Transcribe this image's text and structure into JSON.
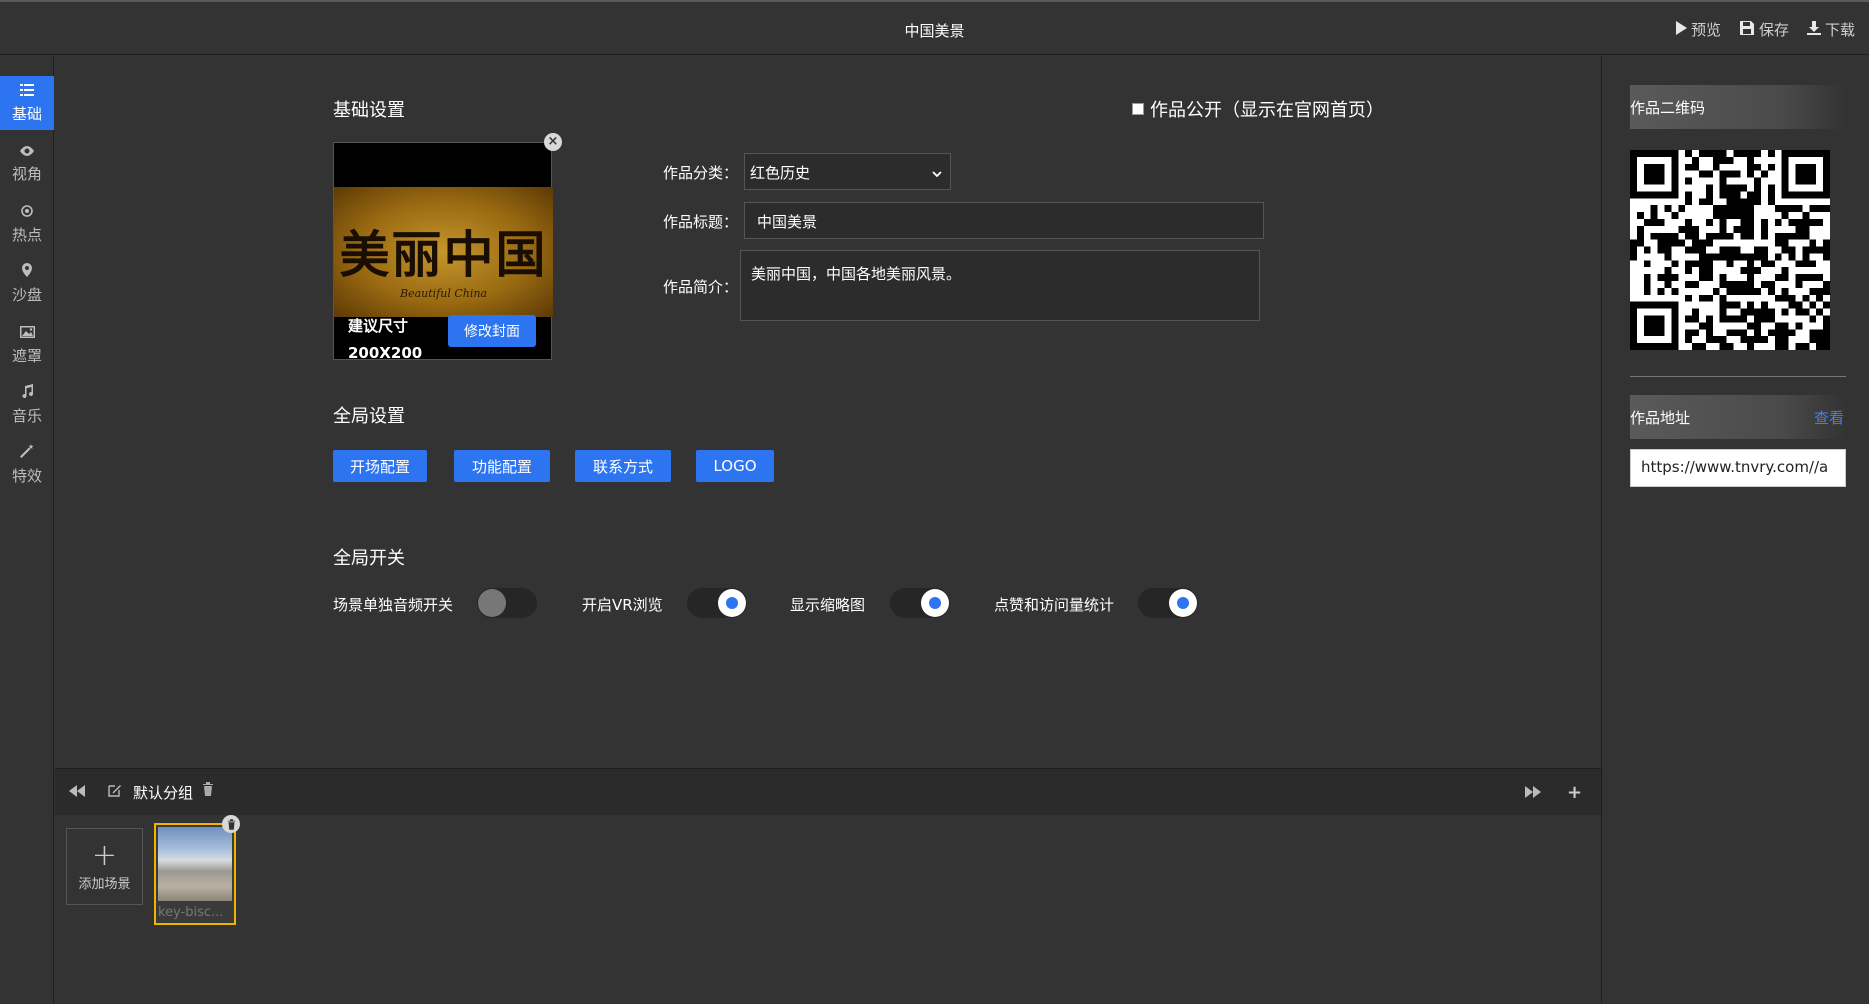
{
  "topbar": {
    "title": "中国美景",
    "actions": [
      {
        "icon": "play-icon",
        "label": "预览"
      },
      {
        "icon": "save-icon",
        "label": "保存"
      },
      {
        "icon": "download-icon",
        "label": "下载"
      }
    ]
  },
  "sidebar": {
    "items": [
      {
        "icon": "list-icon",
        "label": "基础",
        "active": true
      },
      {
        "icon": "eye-icon",
        "label": "视角"
      },
      {
        "icon": "target-icon",
        "label": "热点"
      },
      {
        "icon": "pin-icon",
        "label": "沙盘"
      },
      {
        "icon": "image-icon",
        "label": "遮罩"
      },
      {
        "icon": "music-icon",
        "label": "音乐"
      },
      {
        "icon": "wand-icon",
        "label": "特效"
      }
    ]
  },
  "basic": {
    "title": "基础设置",
    "public_label": "作品公开（显示在官网首页）",
    "cover": {
      "art_text": "美丽中国",
      "art_subtext": "Beautiful China",
      "size_label": "建议尺寸",
      "size_value": "200X200",
      "edit_label": "修改封面"
    },
    "category": {
      "label": "作品分类：",
      "value": "红色历史"
    },
    "work_title": {
      "label": "作品标题：",
      "value": "中国美景"
    },
    "intro": {
      "label": "作品简介：",
      "value": "美丽中国，中国各地美丽风景。"
    }
  },
  "global_settings": {
    "title": "全局设置",
    "buttons": [
      "开场配置",
      "功能配置",
      "联系方式",
      "LOGO"
    ]
  },
  "global_switches": {
    "title": "全局开关",
    "items": [
      {
        "label": "场景单独音频开关",
        "on": false
      },
      {
        "label": "开启VR浏览",
        "on": true
      },
      {
        "label": "显示缩略图",
        "on": true
      },
      {
        "label": "点赞和访问量统计",
        "on": true
      }
    ]
  },
  "right_panel": {
    "qr_title": "作品二维码",
    "address_title": "作品地址",
    "view_label": "查看",
    "url": "https://www.tnvry.com//a"
  },
  "scenes": {
    "group_name": "默认分组",
    "add_label": "添加场景",
    "items": [
      {
        "name": "key-bisc..."
      }
    ]
  },
  "colors": {
    "accent": "#2d75f0",
    "background": "#333333",
    "selected_border": "#f0b400"
  }
}
